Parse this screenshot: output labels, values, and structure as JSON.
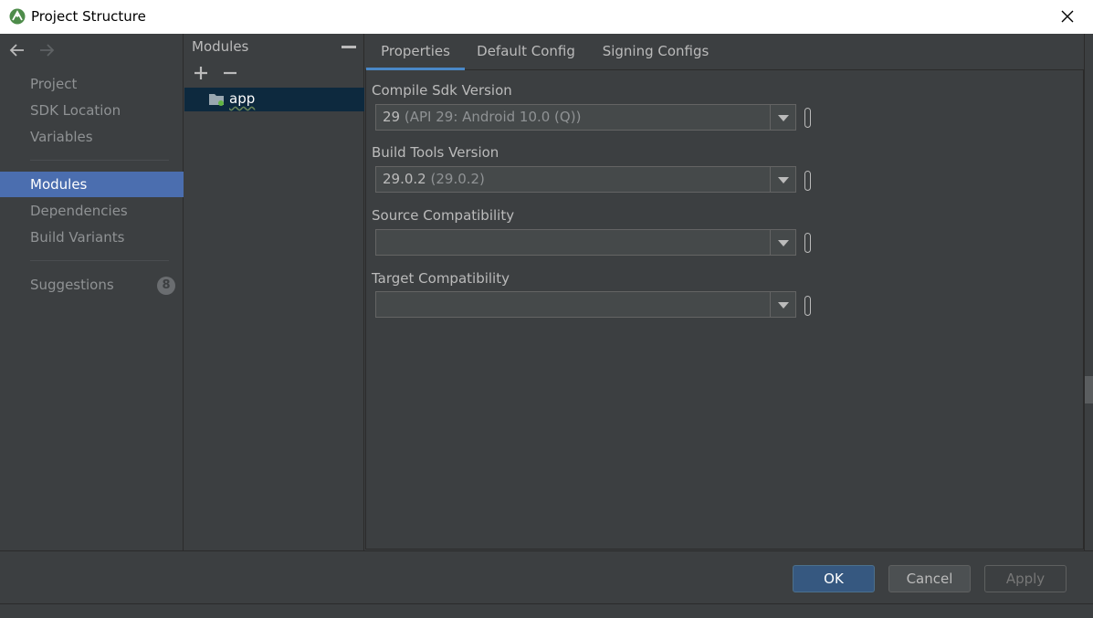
{
  "window": {
    "title": "Project Structure",
    "logo_icon": "android-studio-icon",
    "close_icon": "close-icon"
  },
  "nav": {
    "back_icon": "arrow-left-icon",
    "forward_icon": "arrow-right-icon",
    "items": [
      {
        "label": "Project",
        "active": false
      },
      {
        "label": "SDK Location",
        "active": false
      },
      {
        "label": "Variables",
        "active": false
      },
      {
        "label": "Modules",
        "active": true
      },
      {
        "label": "Dependencies",
        "active": false
      },
      {
        "label": "Build Variants",
        "active": false
      },
      {
        "label": "Suggestions",
        "active": false,
        "badge": "8"
      }
    ]
  },
  "modules": {
    "header": "Modules",
    "add_icon": "plus-icon",
    "remove_icon": "minus-icon",
    "collapse_icon": "minus-icon",
    "items": [
      {
        "label": "app",
        "icon": "module-folder-icon",
        "selected": true
      }
    ]
  },
  "tabs": [
    {
      "label": "Properties",
      "active": true
    },
    {
      "label": "Default Config",
      "active": false
    },
    {
      "label": "Signing Configs",
      "active": false
    }
  ],
  "form": {
    "fields": [
      {
        "label": "Compile Sdk Version",
        "value": "29",
        "detail": "(API 29: Android 10.0 (Q))"
      },
      {
        "label": "Build Tools Version",
        "value": "29.0.2",
        "detail": "(29.0.2)"
      },
      {
        "label": "Source Compatibility",
        "value": "",
        "detail": ""
      },
      {
        "label": "Target Compatibility",
        "value": "",
        "detail": ""
      }
    ]
  },
  "buttons": {
    "ok": "OK",
    "cancel": "Cancel",
    "apply": "Apply"
  },
  "colors": {
    "accent": "#4b6eaf",
    "background": "#3c3f41",
    "selected_row": "#0d293e",
    "tab_underline": "#4a88c7",
    "ok_button": "#365880"
  }
}
